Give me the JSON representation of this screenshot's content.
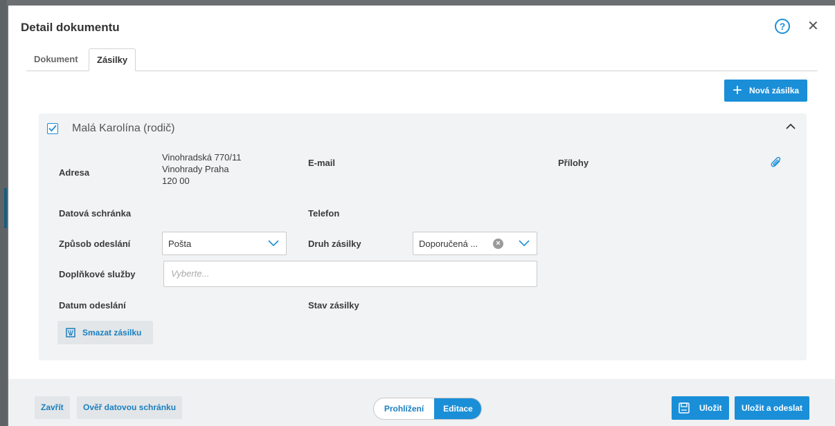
{
  "dialog": {
    "title": "Detail dokumentu"
  },
  "tabs": [
    {
      "label": "Dokument"
    },
    {
      "label": "Zásilky"
    }
  ],
  "toolbar": {
    "new_shipment_label": "Nová zásilka"
  },
  "shipment": {
    "recipient": "Malá Karolína (rodič)",
    "checked": true,
    "labels": {
      "address": "Adresa",
      "email": "E-mail",
      "attachments": "Přílohy",
      "data_box": "Datová schránka",
      "phone": "Telefon",
      "send_method": "Způsob odeslání",
      "shipment_type": "Druh zásilky",
      "extra_services": "Doplňkové služby",
      "send_date": "Datum odeslání",
      "shipment_status": "Stav zásilky"
    },
    "address_lines": [
      "Vinohradská 770/11",
      "Vinohrady Praha",
      "120 00"
    ],
    "send_method_value": "Pošta",
    "shipment_type_value": "Doporučená ...",
    "extra_services_placeholder": "Vyberte...",
    "delete_label": "Smazat zásilku"
  },
  "footer": {
    "close_label": "Zavřít",
    "verify_label": "Ověř datovou schránku",
    "mode_view": "Prohlížení",
    "mode_edit": "Editace",
    "active_mode": "Editace",
    "save_label": "Uložit",
    "save_send_label": "Uložit a odeslat"
  },
  "colors": {
    "accent": "#1a8fd8",
    "link": "#1a7fc0",
    "card_bg": "#f2f3f4"
  },
  "icons": [
    "help-icon",
    "close-icon",
    "plus-icon",
    "checkbox-icon",
    "chevron-up-icon",
    "paperclip-icon",
    "chevron-down-icon",
    "clear-icon",
    "trash-icon",
    "save-icon"
  ]
}
